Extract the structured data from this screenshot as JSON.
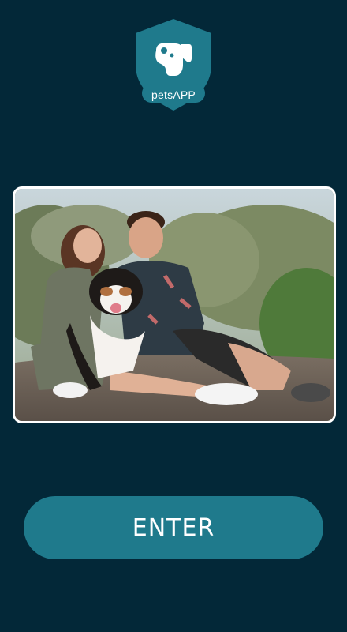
{
  "app": {
    "logo_text": "petsAPP",
    "logo_icon": "dog-shield-icon"
  },
  "hero": {
    "image": "couple-with-dog-photo"
  },
  "actions": {
    "enter_label": "ENTER"
  },
  "colors": {
    "background": "#032838",
    "accent": "#1f7a8c",
    "logo_badge": "#1f7a8c",
    "button_text": "#ffffff"
  }
}
